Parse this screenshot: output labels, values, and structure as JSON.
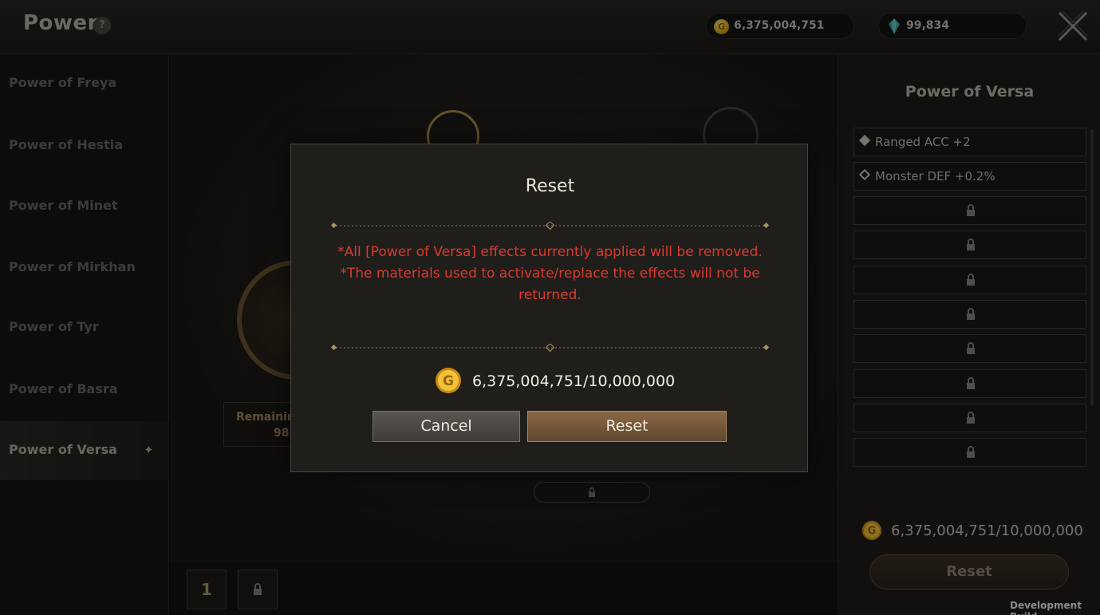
{
  "header": {
    "title": "Power",
    "help_icon": "?",
    "gold_amount": "6,375,004,751",
    "gem_amount": "99,834"
  },
  "sidebar": {
    "items": [
      {
        "label": "Power of Freya"
      },
      {
        "label": "Power of Hestia"
      },
      {
        "label": "Power of Minet"
      },
      {
        "label": "Power of Mirkhan"
      },
      {
        "label": "Power of Tyr"
      },
      {
        "label": "Power of Basra"
      },
      {
        "label": "Power of Versa",
        "active": true
      }
    ]
  },
  "main": {
    "remaining_label": "Remainin",
    "remaining_value": "98",
    "page_label": "1"
  },
  "right_panel": {
    "title": "Power of Versa",
    "effects": [
      {
        "text": "Ranged ACC +2"
      },
      {
        "text": "Monster DEF +0.2%"
      }
    ],
    "locked_slots": 8,
    "cost": "6,375,004,751/10,000,000",
    "reset_label": "Reset"
  },
  "modal": {
    "title": "Reset",
    "warning_line1": "*All [Power of Versa] effects currently applied will be removed.",
    "warning_line2": "*The materials used to activate/replace the effects will not be",
    "warning_line3": "returned.",
    "cost": "6,375,004,751/10,000,000",
    "cancel_label": "Cancel",
    "reset_label": "Reset"
  },
  "footer": {
    "dev_build": "Development Build"
  },
  "colors": {
    "warning": "#d93a2e",
    "gold": "#e0a614",
    "reset_button": "#8a6846"
  }
}
